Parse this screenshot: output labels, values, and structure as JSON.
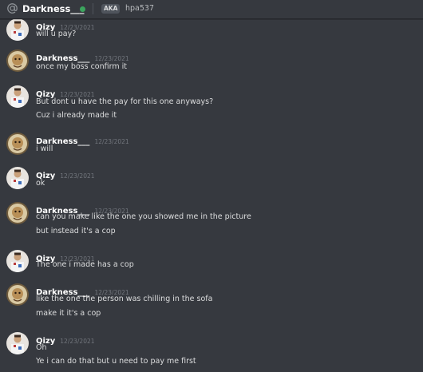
{
  "header": {
    "username": "Darkness___",
    "aka_label": "AKA",
    "alias": "hpa537",
    "status_color": "#3ba55d",
    "icon": "at-icon"
  },
  "messages": [
    {
      "author": "Qizy",
      "timestamp": "12/23/2021",
      "avatar": "qizy",
      "lines": [
        "will u pay?"
      ]
    },
    {
      "author": "Darkness___",
      "timestamp": "12/23/2021",
      "avatar": "darkness",
      "lines": [
        "once my boss confirm it"
      ]
    },
    {
      "author": "Qizy",
      "timestamp": "12/23/2021",
      "avatar": "qizy",
      "lines": [
        "But dont u have the pay for this one anyways?",
        "Cuz i already made it"
      ]
    },
    {
      "author": "Darkness___",
      "timestamp": "12/23/2021",
      "avatar": "darkness",
      "lines": [
        "i will"
      ]
    },
    {
      "author": "Qizy",
      "timestamp": "12/23/2021",
      "avatar": "qizy",
      "lines": [
        "ok"
      ]
    },
    {
      "author": "Darkness___",
      "timestamp": "12/23/2021",
      "avatar": "darkness",
      "lines": [
        "can you make like the one you showed me in the picture",
        "but instead it's a cop"
      ]
    },
    {
      "author": "Qizy",
      "timestamp": "12/23/2021",
      "avatar": "qizy",
      "lines": [
        "The one i made has a cop"
      ]
    },
    {
      "author": "Darkness___",
      "timestamp": "12/23/2021",
      "avatar": "darkness",
      "lines": [
        "like the one the person was chilling in the sofa",
        "make it it's a cop"
      ]
    },
    {
      "author": "Qizy",
      "timestamp": "12/23/2021",
      "avatar": "qizy",
      "lines": [
        "Oh",
        "Ye i can do that but u need to pay me first"
      ]
    }
  ]
}
